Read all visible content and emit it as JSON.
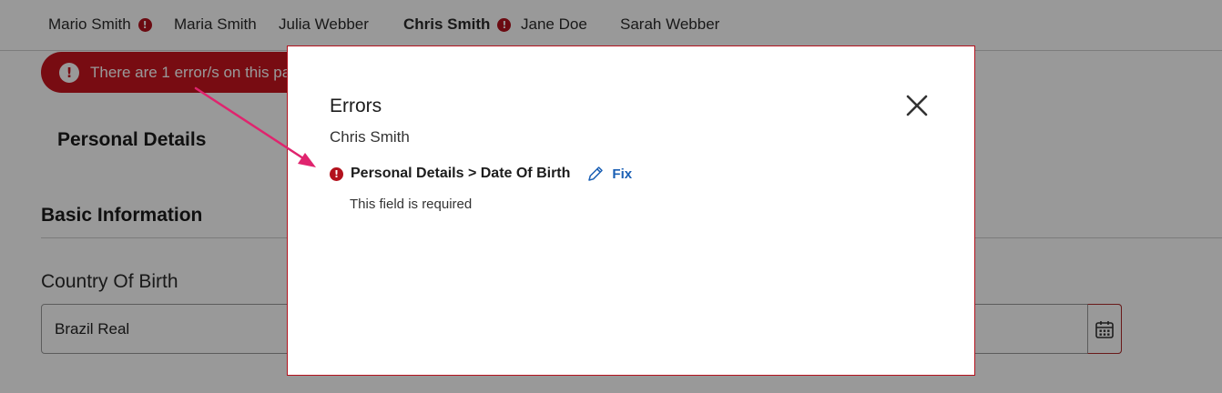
{
  "tabs": [
    {
      "label": "Mario Smith",
      "has_error": true
    },
    {
      "label": "Maria Smith",
      "has_error": false
    },
    {
      "label": "Julia Webber",
      "has_error": false
    },
    {
      "label": "Chris Smith",
      "has_error": true,
      "active": true
    },
    {
      "label": "Jane Doe",
      "has_error": false
    },
    {
      "label": "Sarah Webber",
      "has_error": false
    }
  ],
  "error_badge_glyph": "!",
  "banner": {
    "text": "There are 1 error/s on this page"
  },
  "page": {
    "section_title": "Personal Details",
    "subsection_title": "Basic Information",
    "field_label": "Country Of Birth",
    "field_value": "Brazil Real"
  },
  "modal": {
    "title": "Errors",
    "person": "Chris Smith",
    "error_path": "Personal Details > Date Of Birth",
    "fix_label": "Fix",
    "error_message": "This field is required"
  },
  "colors": {
    "error_red": "#b3121d",
    "banner_red": "#c8141f",
    "link_blue": "#1a5fb4",
    "arrow_pink": "#e0246e"
  },
  "icons": [
    "error-icon",
    "close-icon",
    "pencil-icon",
    "calendar-icon"
  ]
}
